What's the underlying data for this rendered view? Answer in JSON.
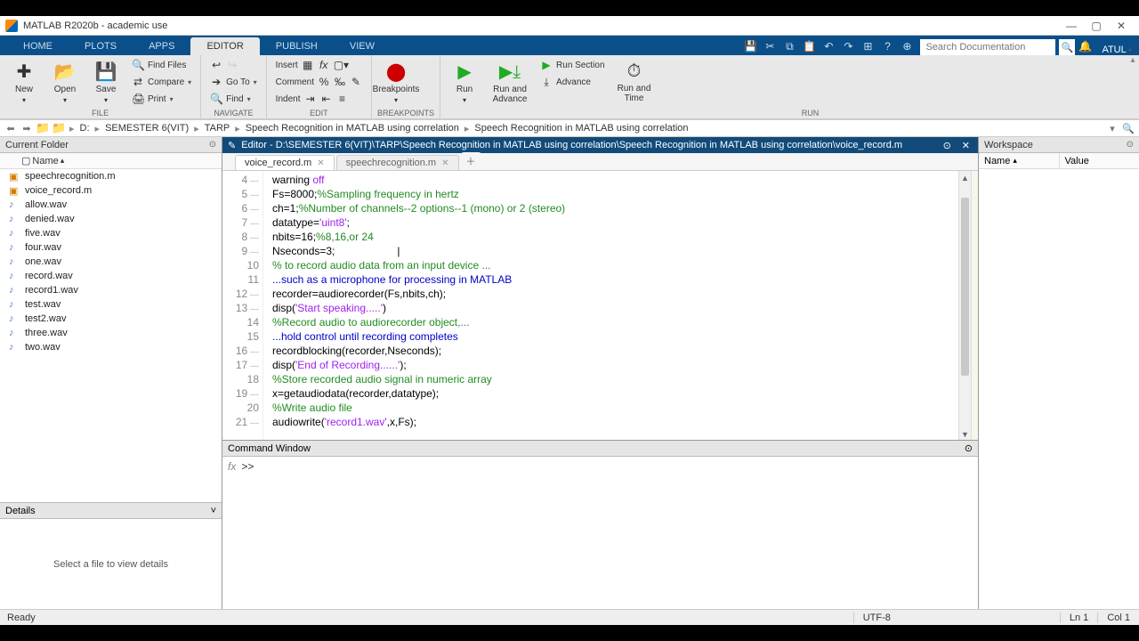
{
  "window": {
    "title": "MATLAB R2020b - academic use"
  },
  "tabs": {
    "items": [
      "HOME",
      "PLOTS",
      "APPS",
      "EDITOR",
      "PUBLISH",
      "VIEW"
    ],
    "active": "EDITOR",
    "search_placeholder": "Search Documentation",
    "user": "ATUL"
  },
  "ribbon": {
    "file": {
      "new": "New",
      "open": "Open",
      "save": "Save",
      "find_files": "Find Files",
      "compare": "Compare",
      "print": "Print",
      "label": "FILE"
    },
    "navigate": {
      "goto": "Go To",
      "find": "Find",
      "label": "NAVIGATE"
    },
    "edit": {
      "insert": "Insert",
      "comment": "Comment",
      "indent": "Indent",
      "label": "EDIT"
    },
    "breakpoints": {
      "breakpoints": "Breakpoints",
      "label": "BREAKPOINTS"
    },
    "run": {
      "run": "Run",
      "run_advance": "Run and\nAdvance",
      "run_section": "Run Section",
      "advance": "Advance",
      "run_time": "Run and\nTime",
      "label": "RUN"
    }
  },
  "address": {
    "drive": "D:",
    "crumbs": [
      "SEMESTER 6(VIT)",
      "TARP",
      "Speech Recognition in MATLAB using correlation",
      "Speech Recognition in MATLAB using correlation"
    ]
  },
  "current_folder": {
    "title": "Current Folder",
    "header": "Name",
    "files": [
      {
        "name": "speechrecognition.m",
        "type": "m"
      },
      {
        "name": "voice_record.m",
        "type": "m"
      },
      {
        "name": "allow.wav",
        "type": "wav"
      },
      {
        "name": "denied.wav",
        "type": "wav"
      },
      {
        "name": "five.wav",
        "type": "wav"
      },
      {
        "name": "four.wav",
        "type": "wav"
      },
      {
        "name": "one.wav",
        "type": "wav"
      },
      {
        "name": "record.wav",
        "type": "wav"
      },
      {
        "name": "record1.wav",
        "type": "wav"
      },
      {
        "name": "test.wav",
        "type": "wav"
      },
      {
        "name": "test2.wav",
        "type": "wav"
      },
      {
        "name": "three.wav",
        "type": "wav"
      },
      {
        "name": "two.wav",
        "type": "wav"
      }
    ]
  },
  "details": {
    "title": "Details",
    "empty": "Select a file to view details"
  },
  "editor": {
    "title": "Editor - D:\\SEMESTER 6(VIT)\\TARP\\Speech Recognition in MATLAB using correlation\\Speech Recognition in MATLAB using correlation\\voice_record.m",
    "tabs": [
      {
        "name": "voice_record.m",
        "active": true
      },
      {
        "name": "speechrecognition.m",
        "active": false
      }
    ],
    "first_line": 4,
    "lines": [
      {
        "n": 4,
        "tokens": [
          {
            "t": "warning ",
            "c": ""
          },
          {
            "t": "off",
            "c": "str"
          }
        ]
      },
      {
        "n": 5,
        "tokens": [
          {
            "t": "Fs=8000;",
            "c": ""
          },
          {
            "t": "%Sampling frequency in hertz",
            "c": "com"
          }
        ]
      },
      {
        "n": 6,
        "tokens": [
          {
            "t": "ch=1;",
            "c": ""
          },
          {
            "t": "%Number of channels--2 options--1 (mono) or 2 (stereo)",
            "c": "com"
          }
        ]
      },
      {
        "n": 7,
        "tokens": [
          {
            "t": "datatype=",
            "c": ""
          },
          {
            "t": "'uint8'",
            "c": "str"
          },
          {
            "t": ";",
            "c": ""
          }
        ]
      },
      {
        "n": 8,
        "tokens": [
          {
            "t": "nbits=16;",
            "c": ""
          },
          {
            "t": "%8,16,or 24",
            "c": "com"
          }
        ]
      },
      {
        "n": 9,
        "tokens": [
          {
            "t": "Nseconds=3;",
            "c": ""
          },
          {
            "t": "                     |",
            "c": ""
          }
        ]
      },
      {
        "n": 10,
        "comment": true,
        "tokens": [
          {
            "t": "% to record audio data from an input device ...",
            "c": "com"
          }
        ]
      },
      {
        "n": 11,
        "comment": true,
        "tokens": [
          {
            "t": "...such as a microphone for processing in MATLAB",
            "c": "kw"
          }
        ]
      },
      {
        "n": 12,
        "tokens": [
          {
            "t": "recorder=audiorecorder(Fs,nbits,ch);",
            "c": ""
          }
        ]
      },
      {
        "n": 13,
        "tokens": [
          {
            "t": "disp(",
            "c": ""
          },
          {
            "t": "'Start speaking.....'",
            "c": "str"
          },
          {
            "t": ")",
            "c": ""
          }
        ]
      },
      {
        "n": 14,
        "comment": true,
        "tokens": [
          {
            "t": "%Record audio to audiorecorder object,...",
            "c": "com"
          }
        ]
      },
      {
        "n": 15,
        "comment": true,
        "tokens": [
          {
            "t": "...hold control until recording completes",
            "c": "kw"
          }
        ]
      },
      {
        "n": 16,
        "tokens": [
          {
            "t": "recordblocking(recorder,Nseconds);",
            "c": ""
          }
        ]
      },
      {
        "n": 17,
        "tokens": [
          {
            "t": "disp(",
            "c": ""
          },
          {
            "t": "'End of Recording......'",
            "c": "str"
          },
          {
            "t": ");",
            "c": ""
          }
        ]
      },
      {
        "n": 18,
        "comment": true,
        "tokens": [
          {
            "t": "%Store recorded audio signal in numeric array",
            "c": "com"
          }
        ]
      },
      {
        "n": 19,
        "tokens": [
          {
            "t": "x=getaudiodata(recorder,datatype);",
            "c": ""
          }
        ]
      },
      {
        "n": 20,
        "comment": true,
        "tokens": [
          {
            "t": "%Write audio file",
            "c": "com"
          }
        ]
      },
      {
        "n": 21,
        "tokens": [
          {
            "t": "audiowrite(",
            "c": ""
          },
          {
            "t": "'record1.wav'",
            "c": "str"
          },
          {
            "t": ",x,Fs);",
            "c": ""
          }
        ]
      }
    ]
  },
  "command_window": {
    "title": "Command Window",
    "prompt": ">>"
  },
  "workspace": {
    "title": "Workspace",
    "cols": [
      "Name",
      "Value"
    ]
  },
  "status": {
    "ready": "Ready",
    "encoding": "UTF-8",
    "ln": "Ln  1",
    "col": "Col  1"
  }
}
